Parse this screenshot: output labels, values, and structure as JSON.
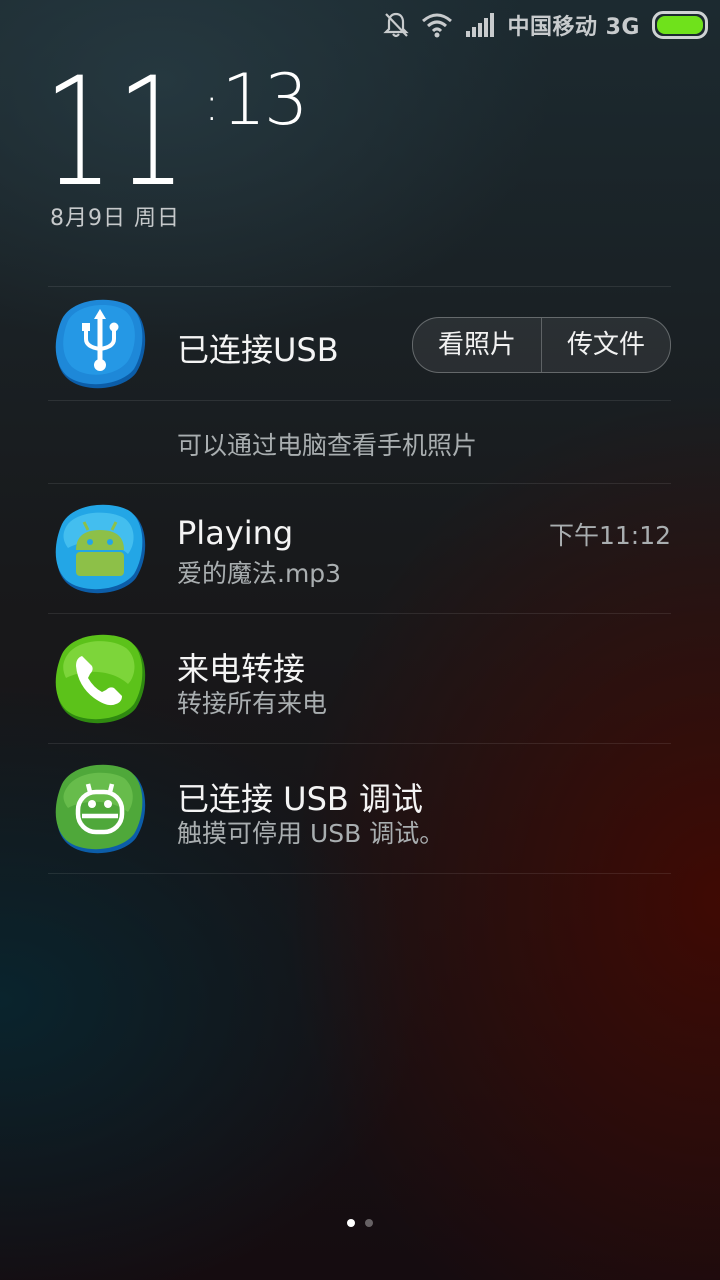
{
  "status_bar": {
    "icons": [
      "bell-muted-icon",
      "wifi-icon",
      "signal-icon",
      "battery-icon"
    ],
    "carrier": "中国移动 3G",
    "battery_level_fraction": 1.0,
    "battery_color": "#6fe21b"
  },
  "clock": {
    "hour": "11",
    "minute": "13",
    "date": "8月9日 周日"
  },
  "notifications": {
    "usb": {
      "icon": "usb-icon",
      "title": "已连接USB",
      "buttons": [
        "看照片",
        "传文件"
      ],
      "subtitle": "可以通过电脑查看手机照片"
    },
    "music": {
      "icon": "android-icon",
      "title": "Playing",
      "subtitle": "爱的魔法.mp3",
      "time": "下午11:12"
    },
    "call_forward": {
      "icon": "phone-icon",
      "title": "来电转接",
      "subtitle": "转接所有来电"
    },
    "usb_debug": {
      "icon": "android-debug-icon",
      "title": "已连接 USB 调试",
      "subtitle": "触摸可停用 USB 调试。"
    }
  },
  "page_indicator": {
    "pages": 2,
    "current": 1
  },
  "colors": {
    "accent_blue": "#1e88d8",
    "accent_green": "#5cc21a"
  }
}
